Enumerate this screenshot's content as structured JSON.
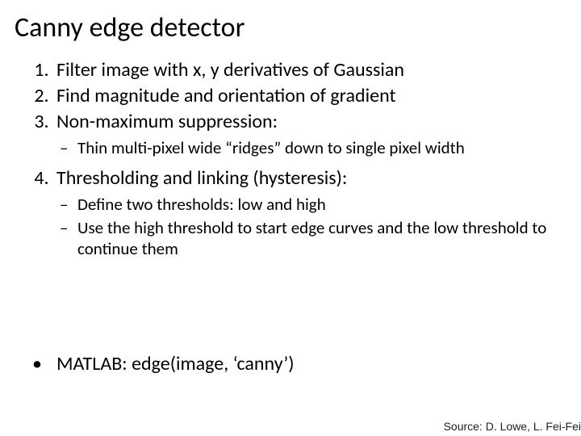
{
  "title": "Canny edge detector",
  "items": {
    "i1": "Filter image with x, y derivatives of Gaussian",
    "i2": "Find magnitude and orientation of gradient",
    "i3": "Non-maximum suppression:",
    "i3_sub1": "Thin multi-pixel wide “ridges” down to single pixel width",
    "i4": "Thresholding and linking (hysteresis):",
    "i4_sub1": "Define two thresholds: low and high",
    "i4_sub2": "Use the high threshold to start edge curves and the low threshold to continue them"
  },
  "matlab": "MATLAB: edge(image, ‘canny’)",
  "source": "Source: D. Lowe, L. Fei-Fei"
}
